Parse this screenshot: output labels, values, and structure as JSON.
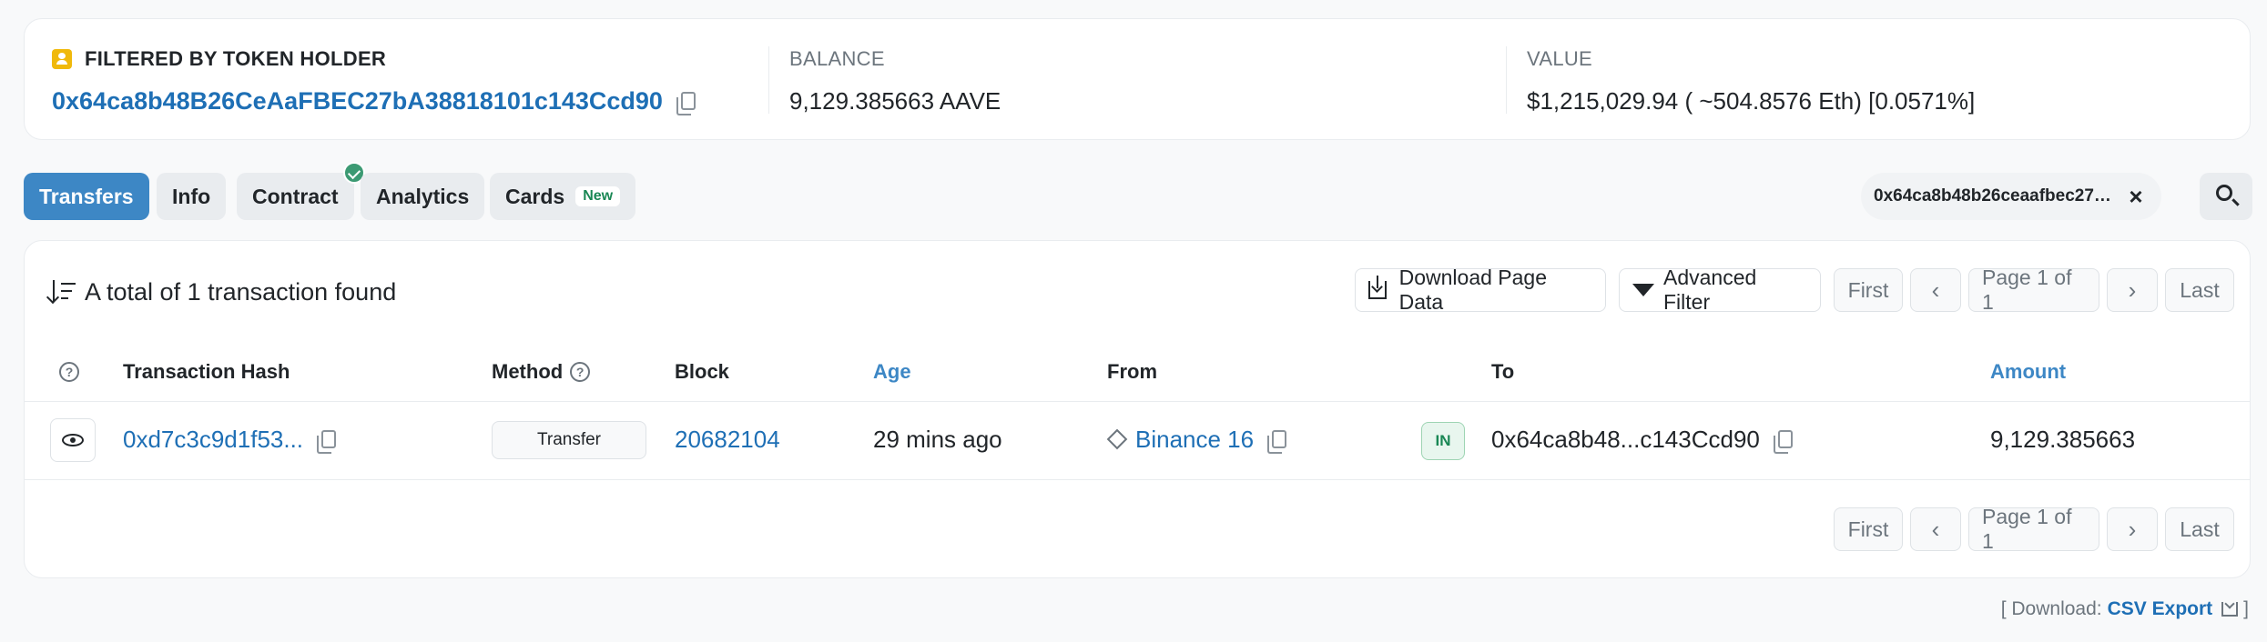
{
  "summary": {
    "filter_label": "FILTERED BY TOKEN HOLDER",
    "holder_address": "0x64ca8b48B26CeAaFBEC27bA38818101c143Ccd90",
    "balance_label": "BALANCE",
    "balance_value": "9,129.385663 AAVE",
    "value_label": "VALUE",
    "value_value": "$1,215,029.94 ( ~504.8576 Eth) [0.0571%]"
  },
  "tabs": [
    {
      "label": "Transfers",
      "active": true
    },
    {
      "label": "Info"
    },
    {
      "label": "Contract"
    },
    {
      "label": "Analytics"
    },
    {
      "label": "Cards",
      "badge": "New"
    }
  ],
  "filter_chip": {
    "text": "0x64ca8b48b26ceaafbec27ba38818101c143ccd90",
    "close": "×"
  },
  "toolbar": {
    "total_text": "A total of 1 transaction found",
    "download_label": "Download Page Data",
    "advanced_filter_label": "Advanced Filter"
  },
  "pagination": {
    "first": "First",
    "prev": "‹",
    "page_text": "Page 1 of 1",
    "next": "›",
    "last": "Last"
  },
  "table": {
    "headers": {
      "hash": "Transaction Hash",
      "method": "Method",
      "block": "Block",
      "age": "Age",
      "from": "From",
      "to": "To",
      "amount": "Amount"
    },
    "rows": [
      {
        "hash": "0xd7c3c9d1f53...",
        "method": "Transfer",
        "block": "20682104",
        "age": "29 mins ago",
        "from": "Binance 16",
        "direction": "IN",
        "to": "0x64ca8b48...c143Ccd90",
        "amount": "9,129.385663"
      }
    ]
  },
  "footer": {
    "prefix": "[ Download:",
    "link": "CSV Export",
    "suffix": "]"
  },
  "colors": {
    "accent": "#3d87c5",
    "link": "#1e6fb5",
    "success": "#198754",
    "holder_icon": "#f0b90b"
  }
}
